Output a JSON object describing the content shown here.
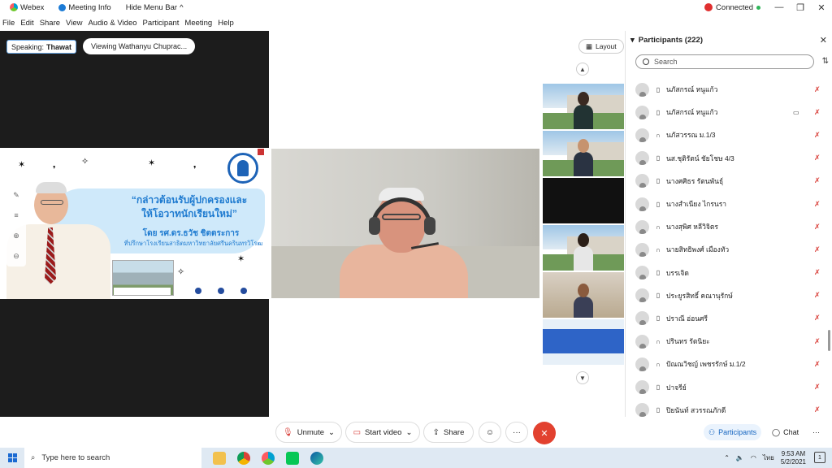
{
  "titlebar": {
    "app": "Webex",
    "meeting_info": "Meeting Info",
    "hide_menu": "Hide Menu Bar",
    "connected": "Connected"
  },
  "menu": [
    "File",
    "Edit",
    "Share",
    "View",
    "Audio & Video",
    "Participant",
    "Meeting",
    "Help"
  ],
  "stage": {
    "speaking_label": "Speaking:",
    "speaking_name": "Thawat",
    "viewing": "Viewing Wathanyu Chuprac...",
    "layout": "Layout"
  },
  "slide": {
    "title_line1": "“กล่าวต้อนรับผู้ปกครองและ",
    "title_line2": "ให้โอวาทนักเรียนใหม่”",
    "by": "โดย รศ.ดร.ธวัช ชิตตระการ",
    "sub": "ที่ปรึกษาโรงเรียนสาธิตมหาวิทยาลัยศรีนครินทรวิโรฒ"
  },
  "participants": {
    "title": "Participants (222)",
    "search_placeholder": "Search",
    "rows": [
      {
        "name": "นภัสกรณ์ หนูแก้ว",
        "device": "phone",
        "cam": false
      },
      {
        "name": "นภัสกรณ์ หนูแก้ว",
        "device": "phone",
        "cam": true
      },
      {
        "name": "นภัสวรรณ ม.1/3",
        "device": "headset",
        "cam": false
      },
      {
        "name": "นส.ชุติรัตน์ ชัยโชษ 4/3",
        "device": "phone",
        "cam": false
      },
      {
        "name": "นางศศิธร รัตนพันธุ์",
        "device": "phone",
        "cam": false
      },
      {
        "name": "นางสำเนียง ไกรนรา",
        "device": "phone",
        "cam": false
      },
      {
        "name": "นางสุพิศ หลีวิจิตร",
        "device": "headset",
        "cam": false
      },
      {
        "name": "นายสิทธิพงศ์ เมืองทัว",
        "device": "headset",
        "cam": false
      },
      {
        "name": "บรรเจิด",
        "device": "phone",
        "cam": false
      },
      {
        "name": "ประยูรสิทธิ์ คณานุรักษ์",
        "device": "phone",
        "cam": false
      },
      {
        "name": "ปราณี อ่อนศรี",
        "device": "phone",
        "cam": false
      },
      {
        "name": "ปรินทร รัตนิยะ",
        "device": "headset",
        "cam": false
      },
      {
        "name": "ปัณณวิชญ์ เพชรรักษ์ ม.1/2",
        "device": "headset",
        "cam": false
      },
      {
        "name": "ปาจรีย์",
        "device": "phone",
        "cam": false
      },
      {
        "name": "ปิยนันท์ สวรรณภักดี",
        "device": "phone",
        "cam": false
      }
    ]
  },
  "controls": {
    "unmute": "Unmute",
    "start_video": "Start video",
    "share": "Share",
    "participants": "Participants",
    "chat": "Chat"
  },
  "taskbar": {
    "search": "Type here to search",
    "time": "9:53 AM",
    "date": "5/2/2021",
    "lang": "ไทย"
  },
  "colors": {
    "accent": "#1565c0",
    "leave": "#e2412f",
    "muted": "#d9403a",
    "connected": "#2fb55a"
  }
}
